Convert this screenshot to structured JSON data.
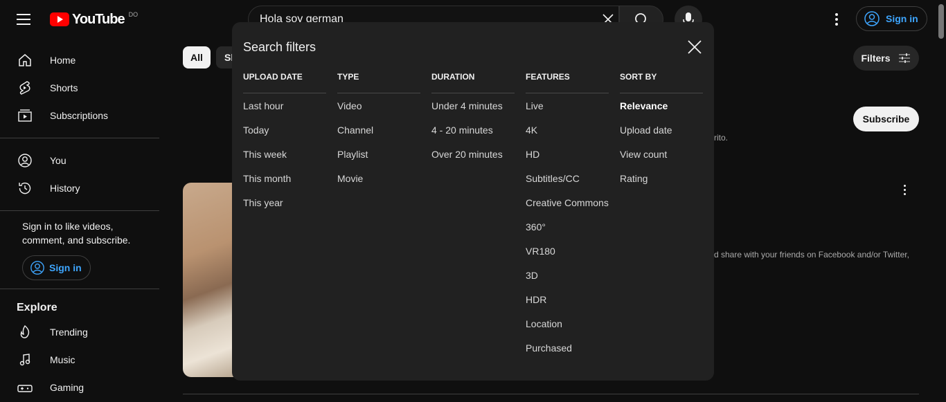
{
  "header": {
    "logo_text": "YouTube",
    "country": "DO",
    "search_value": "Hola soy german",
    "signin_label": "Sign in"
  },
  "sidebar": {
    "items_top": [
      {
        "label": "Home",
        "icon": "home-icon"
      },
      {
        "label": "Shorts",
        "icon": "shorts-icon"
      },
      {
        "label": "Subscriptions",
        "icon": "subscriptions-icon"
      }
    ],
    "items_you": [
      {
        "label": "You",
        "icon": "you-icon"
      },
      {
        "label": "History",
        "icon": "history-icon"
      }
    ],
    "signin_prompt": "Sign in to like videos, comment, and subscribe.",
    "signin_label": "Sign in",
    "explore_heading": "Explore",
    "explore_items": [
      {
        "label": "Trending",
        "icon": "trending-icon"
      },
      {
        "label": "Music",
        "icon": "music-icon"
      },
      {
        "label": "Gaming",
        "icon": "gaming-icon"
      }
    ]
  },
  "content": {
    "chip_all": "All",
    "chip_partial": "Sh",
    "filters_label": "Filters",
    "subscribe_label": "Subscribe",
    "snippet1": "rito.",
    "snippet2": "d share with your friends on Facebook and/or Twitter,"
  },
  "dialog": {
    "title": "Search filters",
    "columns": [
      {
        "heading": "UPLOAD DATE",
        "options": [
          "Last hour",
          "Today",
          "This week",
          "This month",
          "This year"
        ]
      },
      {
        "heading": "TYPE",
        "options": [
          "Video",
          "Channel",
          "Playlist",
          "Movie"
        ]
      },
      {
        "heading": "DURATION",
        "options": [
          "Under 4 minutes",
          "4 - 20 minutes",
          "Over 20 minutes"
        ]
      },
      {
        "heading": "FEATURES",
        "options": [
          "Live",
          "4K",
          "HD",
          "Subtitles/CC",
          "Creative Commons",
          "360°",
          "VR180",
          "3D",
          "HDR",
          "Location",
          "Purchased"
        ]
      },
      {
        "heading": "SORT BY",
        "options": [
          "Relevance",
          "Upload date",
          "View count",
          "Rating"
        ]
      }
    ],
    "selected_sort": "Relevance"
  }
}
